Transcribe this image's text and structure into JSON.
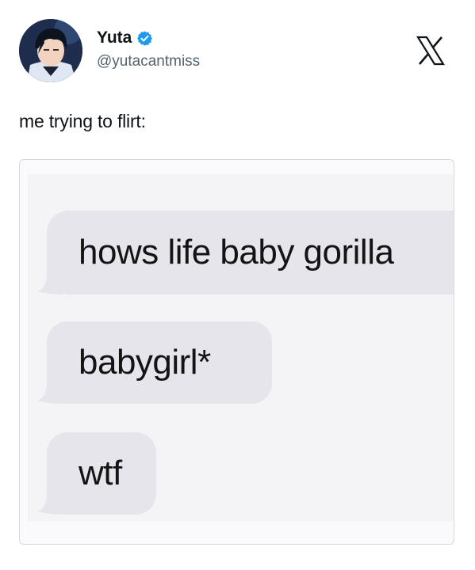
{
  "tweet": {
    "display_name": "Yuta",
    "handle": "@yutacantmiss",
    "verified_icon": "verified-badge-icon",
    "brand_icon": "x-logo-icon",
    "text": "me trying to flirt:",
    "accent_color": "#1d9bf0"
  },
  "media": {
    "messages": [
      {
        "text": "hows life baby gorilla"
      },
      {
        "text": "babygirl*"
      },
      {
        "text": "wtf"
      }
    ]
  }
}
